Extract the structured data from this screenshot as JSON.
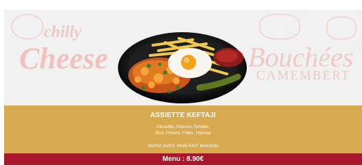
{
  "card": {
    "watermark": {
      "brand_line1": "chilly",
      "brand_line2": "Cheese",
      "sub_line1": "Bouchées",
      "sub_line2": "CAMEMBERT"
    },
    "title": "ASSIETTE KEFTAJI",
    "description_line1": "Citrouille, Poivron, Tomate,",
    "description_line2": "Œuf, Piment, Frites, Harissa",
    "note": "SERVI AVEC PAIN FAIT MAISON",
    "price_label": "Menu : 8.90€"
  },
  "colors": {
    "band": "#d8aa50",
    "price_bar": "#a8182a",
    "background": "#f2f1f1",
    "watermark": "#efbab4"
  }
}
